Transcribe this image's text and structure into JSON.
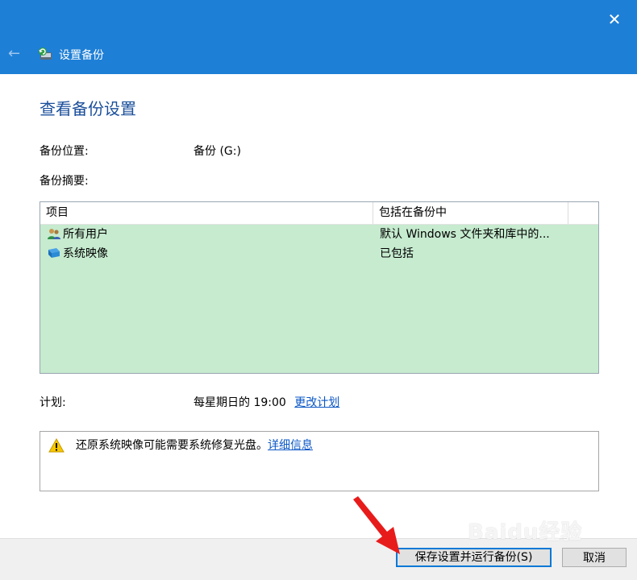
{
  "window": {
    "title": "设置备份",
    "close_glyph": "✕",
    "back_glyph": "←",
    "accent": "#1e7fd6"
  },
  "main": {
    "heading": "查看备份设置",
    "location_label": "备份位置:",
    "location_value": "备份 (G:)",
    "summary_label": "备份摘要:",
    "table": {
      "headers": [
        "项目",
        "包括在备份中"
      ],
      "rows": [
        {
          "icon": "users-icon",
          "item": "所有用户",
          "included": "默认 Windows 文件夹和库中的..."
        },
        {
          "icon": "system-image-icon",
          "item": "系统映像",
          "included": "已包括"
        }
      ]
    },
    "schedule_label": "计划:",
    "schedule_value": "每星期日的 19:00",
    "change_schedule_link": "更改计划",
    "notice": {
      "icon": "warning-icon",
      "text": "还原系统映像可能需要系统修复光盘。",
      "link": "详细信息"
    }
  },
  "footer": {
    "save_button": "保存设置并运行备份(S)",
    "cancel_button": "取消"
  },
  "watermark": "Baidu经验"
}
